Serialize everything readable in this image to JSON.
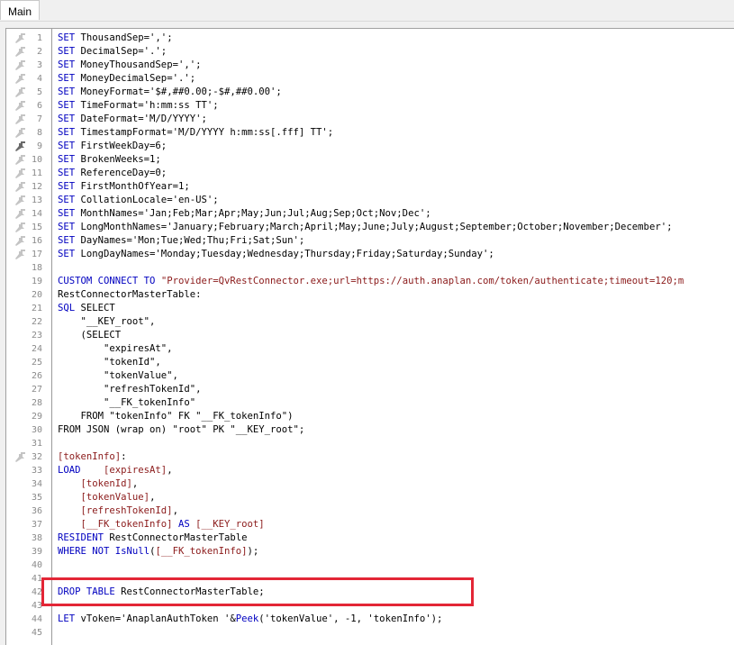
{
  "tabs": [
    {
      "label": "Main"
    }
  ],
  "lines": [
    {
      "n": "1",
      "pin": "grey",
      "parts": [
        {
          "t": "kw",
          "v": "SET"
        },
        {
          "t": "p",
          "v": " ThousandSep=','"
        },
        {
          "t": "p",
          "v": ";"
        }
      ]
    },
    {
      "n": "2",
      "pin": "grey",
      "parts": [
        {
          "t": "kw",
          "v": "SET"
        },
        {
          "t": "p",
          "v": " DecimalSep='.';"
        }
      ]
    },
    {
      "n": "3",
      "pin": "grey",
      "parts": [
        {
          "t": "kw",
          "v": "SET"
        },
        {
          "t": "p",
          "v": " MoneyThousandSep=',';"
        }
      ]
    },
    {
      "n": "4",
      "pin": "grey",
      "parts": [
        {
          "t": "kw",
          "v": "SET"
        },
        {
          "t": "p",
          "v": " MoneyDecimalSep='.';"
        }
      ]
    },
    {
      "n": "5",
      "pin": "grey",
      "parts": [
        {
          "t": "kw",
          "v": "SET"
        },
        {
          "t": "p",
          "v": " MoneyFormat='$#,##0.00;-$#,##0.00';"
        }
      ]
    },
    {
      "n": "6",
      "pin": "grey",
      "parts": [
        {
          "t": "kw",
          "v": "SET"
        },
        {
          "t": "p",
          "v": " TimeFormat='h:mm:ss TT';"
        }
      ]
    },
    {
      "n": "7",
      "pin": "grey",
      "parts": [
        {
          "t": "kw",
          "v": "SET"
        },
        {
          "t": "p",
          "v": " DateFormat='M/D/YYYY';"
        }
      ]
    },
    {
      "n": "8",
      "pin": "grey",
      "parts": [
        {
          "t": "kw",
          "v": "SET"
        },
        {
          "t": "p",
          "v": " TimestampFormat='M/D/YYYY h:mm:ss[.fff] TT';"
        }
      ]
    },
    {
      "n": "9",
      "pin": "dark",
      "parts": [
        {
          "t": "kw",
          "v": "SET"
        },
        {
          "t": "p",
          "v": " FirstWeekDay=6;"
        }
      ]
    },
    {
      "n": "10",
      "pin": "grey",
      "parts": [
        {
          "t": "kw",
          "v": "SET"
        },
        {
          "t": "p",
          "v": " BrokenWeeks=1;"
        }
      ]
    },
    {
      "n": "11",
      "pin": "grey",
      "parts": [
        {
          "t": "kw",
          "v": "SET"
        },
        {
          "t": "p",
          "v": " ReferenceDay=0;"
        }
      ]
    },
    {
      "n": "12",
      "pin": "grey",
      "parts": [
        {
          "t": "kw",
          "v": "SET"
        },
        {
          "t": "p",
          "v": " FirstMonthOfYear=1;"
        }
      ]
    },
    {
      "n": "13",
      "pin": "grey",
      "parts": [
        {
          "t": "kw",
          "v": "SET"
        },
        {
          "t": "p",
          "v": " CollationLocale='en-US';"
        }
      ]
    },
    {
      "n": "14",
      "pin": "grey",
      "parts": [
        {
          "t": "kw",
          "v": "SET"
        },
        {
          "t": "p",
          "v": " MonthNames='Jan;Feb;Mar;Apr;May;Jun;Jul;Aug;Sep;Oct;Nov;Dec';"
        }
      ]
    },
    {
      "n": "15",
      "pin": "grey",
      "parts": [
        {
          "t": "kw",
          "v": "SET"
        },
        {
          "t": "p",
          "v": " LongMonthNames='January;February;March;April;May;June;July;August;September;October;November;December';"
        }
      ]
    },
    {
      "n": "16",
      "pin": "grey",
      "parts": [
        {
          "t": "kw",
          "v": "SET"
        },
        {
          "t": "p",
          "v": " DayNames='Mon;Tue;Wed;Thu;Fri;Sat;Sun';"
        }
      ]
    },
    {
      "n": "17",
      "pin": "grey",
      "parts": [
        {
          "t": "kw",
          "v": "SET"
        },
        {
          "t": "p",
          "v": " LongDayNames='Monday;Tuesday;Wednesday;Thursday;Friday;Saturday;Sunday';"
        }
      ]
    },
    {
      "n": "18",
      "pin": "",
      "parts": []
    },
    {
      "n": "19",
      "pin": "",
      "parts": [
        {
          "t": "kw",
          "v": "CUSTOM CONNECT TO"
        },
        {
          "t": "lit",
          "v": " \"Provider=QvRestConnector.exe;url=https://auth.anaplan.com/token/authenticate;timeout=120;m"
        }
      ]
    },
    {
      "n": "20",
      "pin": "",
      "parts": [
        {
          "t": "p",
          "v": "RestConnectorMasterTable:"
        }
      ]
    },
    {
      "n": "21",
      "pin": "",
      "parts": [
        {
          "t": "kw",
          "v": "SQL"
        },
        {
          "t": "p",
          "v": " SELECT"
        }
      ]
    },
    {
      "n": "22",
      "pin": "",
      "parts": [
        {
          "t": "p",
          "v": "    \"__KEY_root\","
        }
      ]
    },
    {
      "n": "23",
      "pin": "",
      "parts": [
        {
          "t": "p",
          "v": "    (SELECT"
        }
      ]
    },
    {
      "n": "24",
      "pin": "",
      "parts": [
        {
          "t": "p",
          "v": "        \"expiresAt\","
        }
      ]
    },
    {
      "n": "25",
      "pin": "",
      "parts": [
        {
          "t": "p",
          "v": "        \"tokenId\","
        }
      ]
    },
    {
      "n": "26",
      "pin": "",
      "parts": [
        {
          "t": "p",
          "v": "        \"tokenValue\","
        }
      ]
    },
    {
      "n": "27",
      "pin": "",
      "parts": [
        {
          "t": "p",
          "v": "        \"refreshTokenId\","
        }
      ]
    },
    {
      "n": "28",
      "pin": "",
      "parts": [
        {
          "t": "p",
          "v": "        \"__FK_tokenInfo\""
        }
      ]
    },
    {
      "n": "29",
      "pin": "",
      "parts": [
        {
          "t": "p",
          "v": "    FROM \"tokenInfo\" FK \"__FK_tokenInfo\")"
        }
      ]
    },
    {
      "n": "30",
      "pin": "",
      "parts": [
        {
          "t": "p",
          "v": "FROM JSON (wrap on) \"root\" PK \"__KEY_root\";"
        }
      ]
    },
    {
      "n": "31",
      "pin": "",
      "parts": []
    },
    {
      "n": "32",
      "pin": "grey",
      "parts": [
        {
          "t": "fld",
          "v": "[tokenInfo]"
        },
        {
          "t": "p",
          "v": ":"
        }
      ]
    },
    {
      "n": "33",
      "pin": "",
      "parts": [
        {
          "t": "kw",
          "v": "LOAD"
        },
        {
          "t": "p",
          "v": "    "
        },
        {
          "t": "fld",
          "v": "[expiresAt]"
        },
        {
          "t": "p",
          "v": ","
        }
      ]
    },
    {
      "n": "34",
      "pin": "",
      "parts": [
        {
          "t": "p",
          "v": "    "
        },
        {
          "t": "fld",
          "v": "[tokenId]"
        },
        {
          "t": "p",
          "v": ","
        }
      ]
    },
    {
      "n": "35",
      "pin": "",
      "parts": [
        {
          "t": "p",
          "v": "    "
        },
        {
          "t": "fld",
          "v": "[tokenValue]"
        },
        {
          "t": "p",
          "v": ","
        }
      ]
    },
    {
      "n": "36",
      "pin": "",
      "parts": [
        {
          "t": "p",
          "v": "    "
        },
        {
          "t": "fld",
          "v": "[refreshTokenId]"
        },
        {
          "t": "p",
          "v": ","
        }
      ]
    },
    {
      "n": "37",
      "pin": "",
      "parts": [
        {
          "t": "p",
          "v": "    "
        },
        {
          "t": "fld",
          "v": "[__FK_tokenInfo]"
        },
        {
          "t": "p",
          "v": " "
        },
        {
          "t": "kw",
          "v": "AS"
        },
        {
          "t": "p",
          "v": " "
        },
        {
          "t": "fld",
          "v": "[__KEY_root]"
        }
      ]
    },
    {
      "n": "38",
      "pin": "",
      "parts": [
        {
          "t": "kw",
          "v": "RESIDENT"
        },
        {
          "t": "p",
          "v": " RestConnectorMasterTable"
        }
      ]
    },
    {
      "n": "39",
      "pin": "",
      "parts": [
        {
          "t": "kw",
          "v": "WHERE NOT"
        },
        {
          "t": "p",
          "v": " "
        },
        {
          "t": "fn",
          "v": "IsNull"
        },
        {
          "t": "p",
          "v": "("
        },
        {
          "t": "fld",
          "v": "[__FK_tokenInfo]"
        },
        {
          "t": "p",
          "v": ");"
        }
      ]
    },
    {
      "n": "40",
      "pin": "",
      "parts": []
    },
    {
      "n": "41",
      "pin": "",
      "parts": []
    },
    {
      "n": "42",
      "pin": "",
      "parts": [
        {
          "t": "kw",
          "v": "DROP TABLE"
        },
        {
          "t": "p",
          "v": " RestConnectorMasterTable;"
        }
      ]
    },
    {
      "n": "43",
      "pin": "",
      "parts": []
    },
    {
      "n": "44",
      "pin": "",
      "parts": [
        {
          "t": "kw",
          "v": "LET"
        },
        {
          "t": "p",
          "v": " vToken='AnaplanAuthToken '&"
        },
        {
          "t": "fn",
          "v": "Peek"
        },
        {
          "t": "p",
          "v": "('tokenValue', -1, 'tokenInfo');"
        }
      ]
    },
    {
      "n": "45",
      "pin": "",
      "parts": []
    }
  ]
}
